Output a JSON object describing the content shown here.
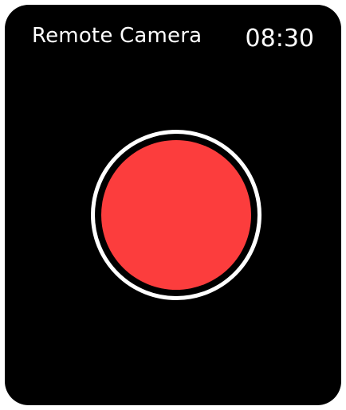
{
  "app": {
    "title": "Remote Camera",
    "time": "08:30"
  },
  "shutter": {
    "icon": "record-button",
    "ring_color": "#ffffff",
    "fill_color": "#fc3d3d"
  },
  "theme": {
    "background": "#000000",
    "text_color": "#ffffff"
  }
}
